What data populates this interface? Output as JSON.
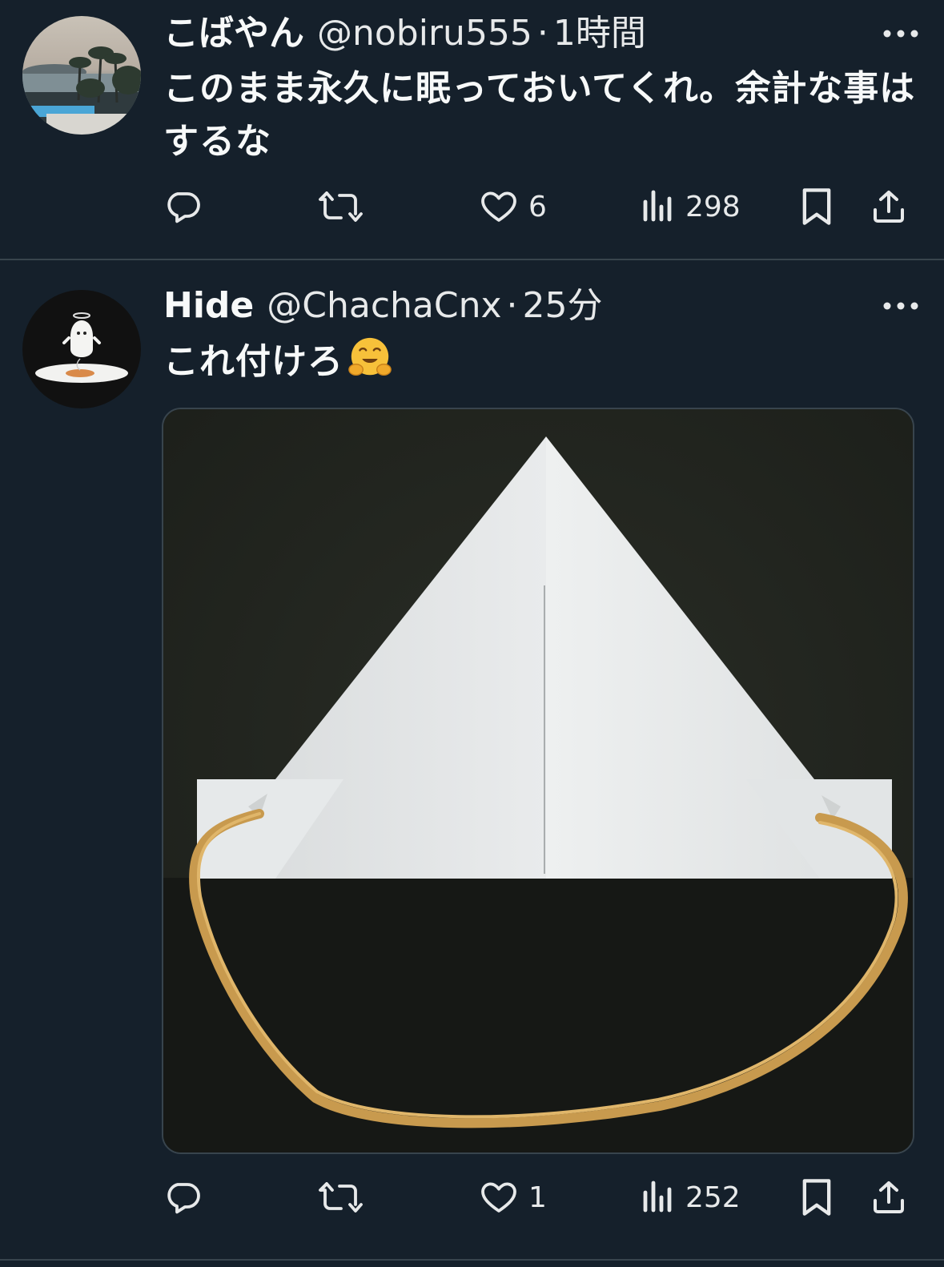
{
  "tweets": [
    {
      "name": "こばやん",
      "handle": "@nobiru555",
      "separator": "·",
      "time": "1時間",
      "text": "このまま永久に眠っておいてくれ。余計な事はするな",
      "likes": "6",
      "views": "298",
      "avatar_icon": "landscape-avatar-photo"
    },
    {
      "name": "Hide",
      "handle": "@ChachaCnx",
      "separator": "·",
      "time": "25分",
      "text": "これ付けろ",
      "emoji_icon": "hugging-face-emoji",
      "likes": "1",
      "views": "252",
      "avatar_icon": "ghost-angel-avatar",
      "media_icon": "paper-hat-with-rubber-band-photo"
    }
  ],
  "colors": {
    "background": "#15202b",
    "divider": "#38444d",
    "text": "#f7f9f9",
    "icon": "#e7e9ea"
  }
}
